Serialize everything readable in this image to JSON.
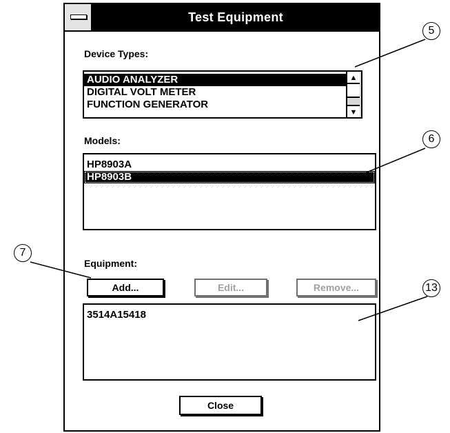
{
  "dialog": {
    "title": "Test Equipment",
    "device_types": {
      "label": "Device Types:",
      "items": [
        "AUDIO ANALYZER",
        "DIGITAL VOLT METER",
        "FUNCTION GENERATOR"
      ],
      "selected_index": 0
    },
    "models": {
      "label": "Models:",
      "items": [
        "HP8903A",
        "HP8903B"
      ],
      "selected_index": 1
    },
    "equipment": {
      "label": "Equipment:",
      "add_label": "Add...",
      "edit_label": "Edit...",
      "remove_label": "Remove...",
      "items": [
        "3514A15418"
      ]
    },
    "close_label": "Close"
  },
  "callouts": [
    "5",
    "6",
    "7",
    "13"
  ],
  "icons": {
    "system_menu": "minus-bar",
    "scroll_up": "up-arrow",
    "scroll_down": "down-arrow"
  }
}
